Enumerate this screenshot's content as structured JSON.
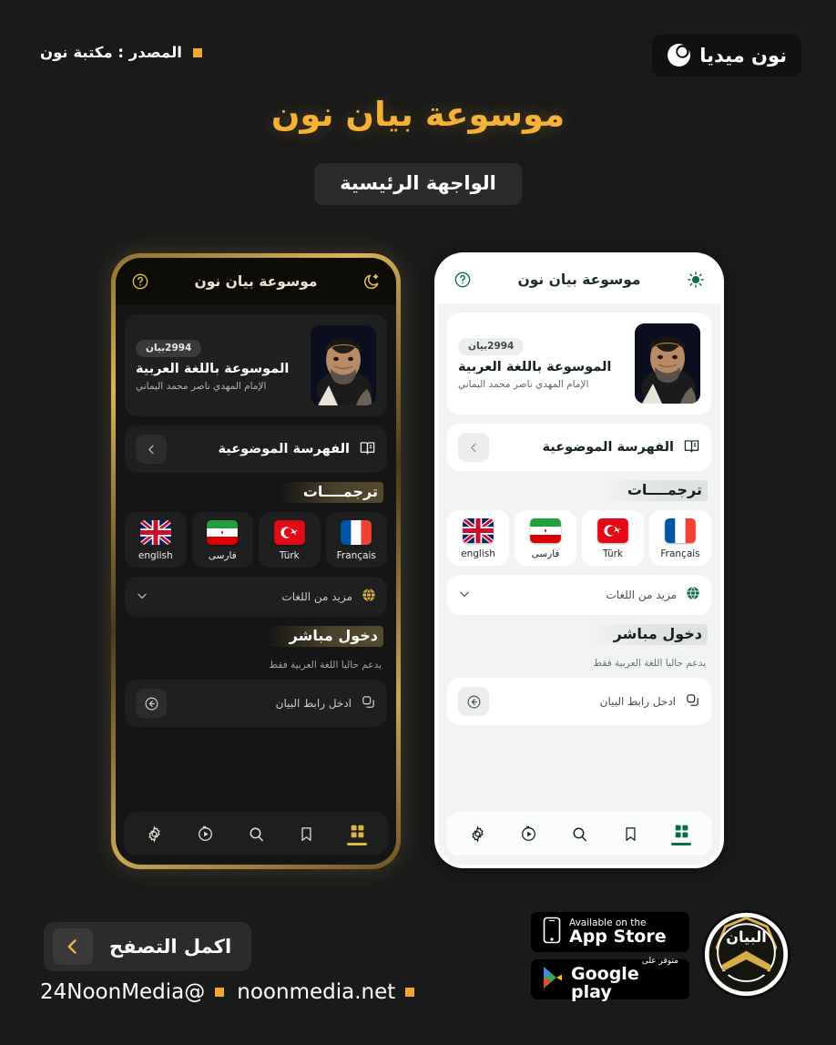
{
  "header": {
    "source_label": "المصدر : مكتبة نون",
    "logo_text": "نون ميديا",
    "logo_icon": "crescent-circle-icon"
  },
  "title": {
    "main": "موسوعة بيان نون",
    "badge": "الواجهة الرئيسية"
  },
  "colors": {
    "gold": "#f5b335",
    "orange_bullet": "#f0a832",
    "page_bg": "#1a1a1a",
    "dark_screen": "#151515",
    "light_screen": "#f2f4f3",
    "light_accent_green": "#0b6b4f"
  },
  "app": {
    "header": {
      "title": "موسوعة بيان نون",
      "theme_icon_dark": "moon-star-icon",
      "theme_icon_light": "sun-icon",
      "help_icon": "question-circle-icon"
    },
    "profile": {
      "count_pill": "2994بيان",
      "name": "الموسوعة باللغة العربية",
      "subtitle": "الإمام المهدي ناصر محمد اليماني",
      "avatar": "portrait-avatar"
    },
    "index_row": {
      "label": "الفهرسة الموضوعية",
      "icon": "index-book-icon",
      "chevron": "chevron-left-icon"
    },
    "translations": {
      "section_title": "ترجمــــات",
      "items": [
        {
          "label": "english",
          "flag": "uk-flag"
        },
        {
          "label": "فارسی",
          "flag": "iran-flag"
        },
        {
          "label": "Türk",
          "flag": "turkey-flag"
        },
        {
          "label": "Français",
          "flag": "france-flag"
        }
      ],
      "more_label": "مزيد من اللغات",
      "more_icon": "globe-icon",
      "more_chevron": "chevron-down-icon"
    },
    "direct_entry": {
      "section_title": "دخول مباشر",
      "note": "يدعم حاليا اللغة العربية فقط",
      "input_label": "ادخل رابط البيان",
      "input_icon": "copy-link-icon",
      "submit_icon": "arrow-left-circle-icon"
    },
    "nav": [
      {
        "name": "grid",
        "icon": "grid-icon",
        "active": true
      },
      {
        "name": "bookmark",
        "icon": "bookmark-icon",
        "active": false
      },
      {
        "name": "search",
        "icon": "search-icon",
        "active": false
      },
      {
        "name": "history",
        "icon": "history-play-icon",
        "active": false
      },
      {
        "name": "settings",
        "icon": "gear-icon",
        "active": false
      }
    ]
  },
  "footer": {
    "cta_label": "اكمل التصفح",
    "cta_icon": "chevron-left-icon",
    "links": [
      {
        "text": "@24NoonMedia"
      },
      {
        "text": "noonmedia.net"
      }
    ],
    "stores": {
      "appstore_small": "Available on the",
      "appstore_big": "App Store",
      "googleplay_small": "متوفر على",
      "googleplay_big": "Google play"
    },
    "brand_logo_text": "البيان"
  }
}
